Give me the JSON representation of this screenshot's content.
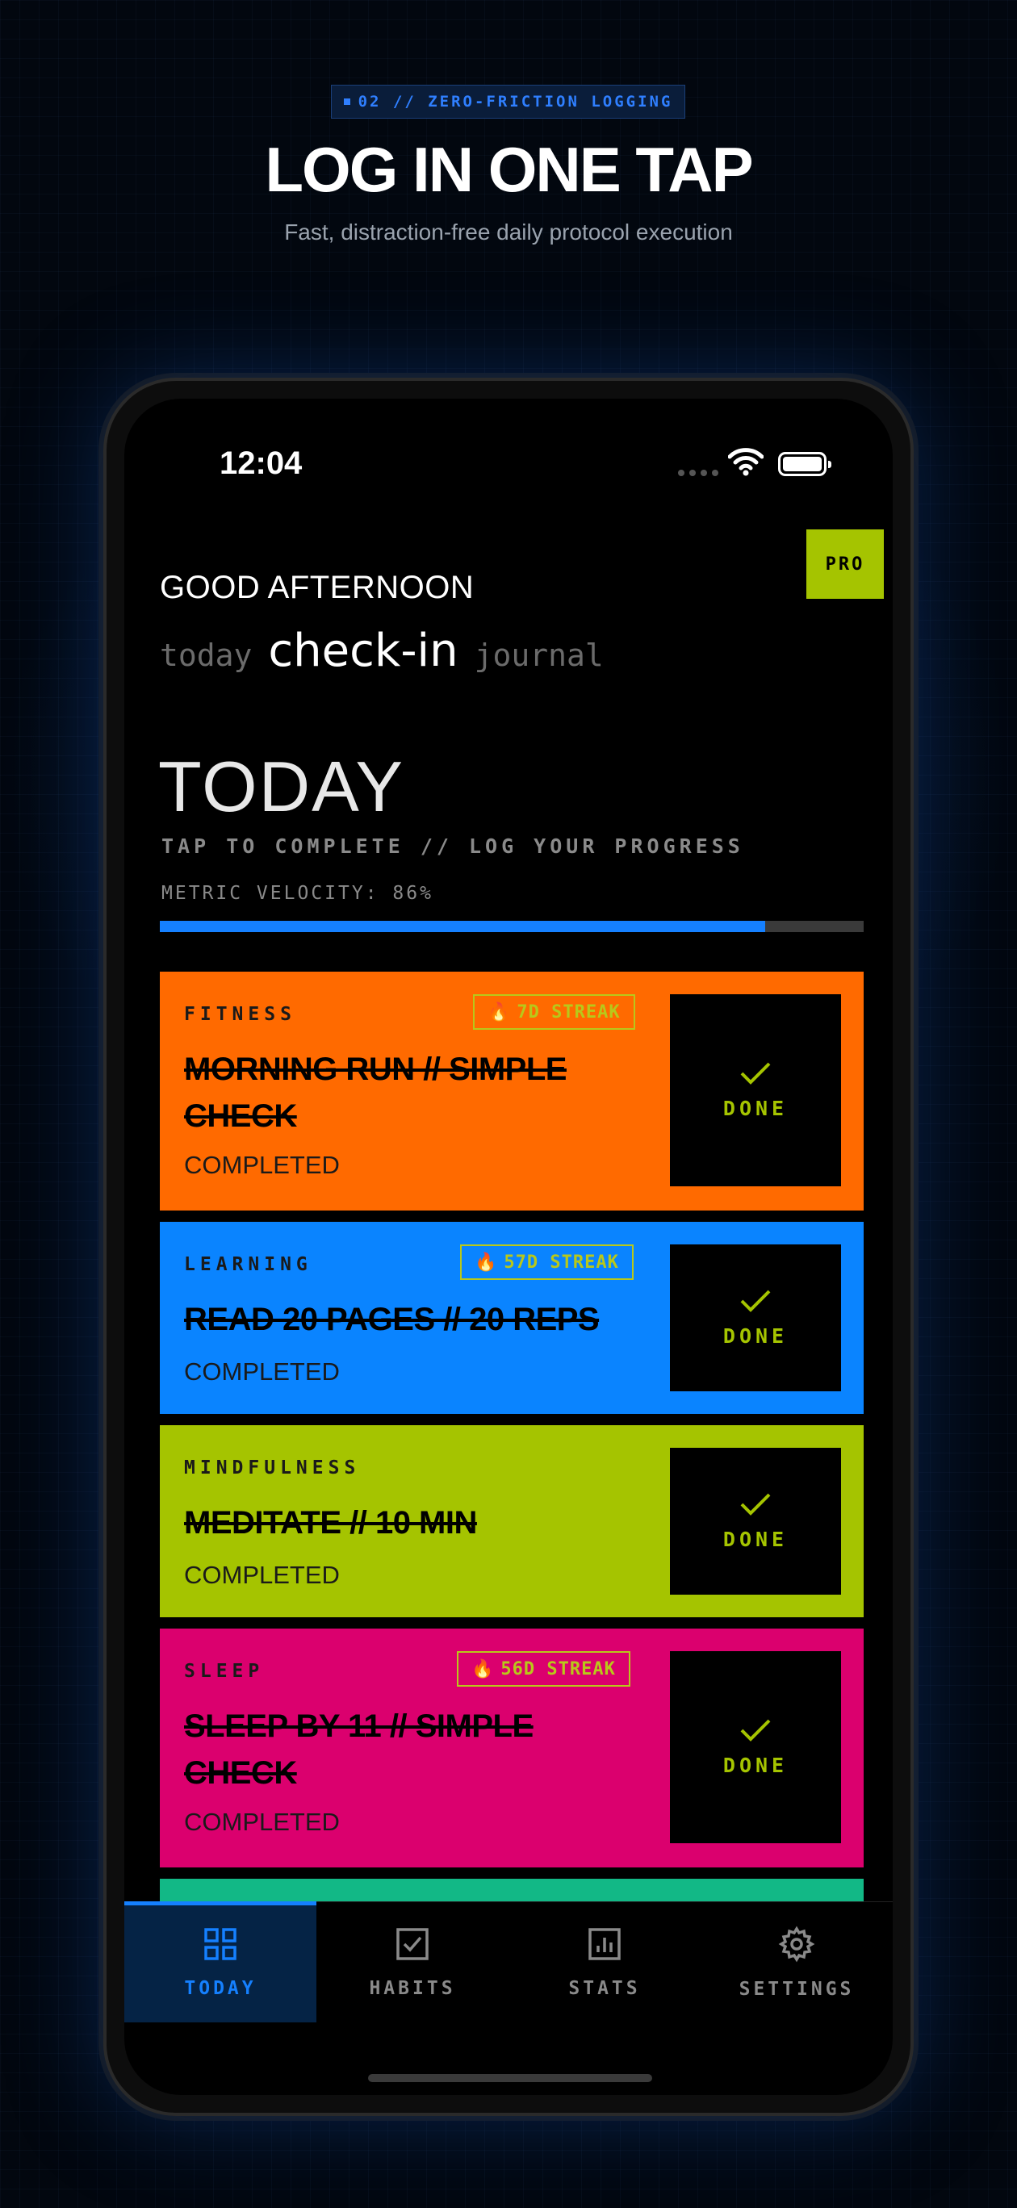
{
  "hero": {
    "badge": "02 // ZERO-FRICTION LOGGING",
    "title": "LOG IN ONE TAP",
    "subtitle": "Fast, distraction-free daily protocol execution"
  },
  "status": {
    "time": "12:04"
  },
  "header": {
    "pro": "PRO",
    "greeting": "GOOD AFTERNOON",
    "tabs": [
      {
        "label": "today",
        "active": false
      },
      {
        "label": "check-in",
        "active": true
      },
      {
        "label": "journal",
        "active": false
      }
    ]
  },
  "section": {
    "title": "TODAY",
    "subtitle": "TAP TO COMPLETE // LOG YOUR PROGRESS",
    "velocity_label": "METRIC VELOCITY: 86%",
    "velocity_value": 86
  },
  "habits": [
    {
      "category": "FITNESS",
      "streak": "7D STREAK",
      "name": "MORNING RUN // SIMPLE CHECK",
      "state": "COMPLETED",
      "done_label": "DONE",
      "color": "#ff6a00"
    },
    {
      "category": "LEARNING",
      "streak": "57D STREAK",
      "name": "READ 20 PAGES // 20 REPS",
      "state": "COMPLETED",
      "done_label": "DONE",
      "color": "#0a84ff"
    },
    {
      "category": "MINDFULNESS",
      "streak": "",
      "name": "MEDITATE // 10 MIN",
      "state": "COMPLETED",
      "done_label": "DONE",
      "color": "#a5c400"
    },
    {
      "category": "SLEEP",
      "streak": "56D STREAK",
      "name": "SLEEP BY 11 // SIMPLE CHECK",
      "state": "COMPLETED",
      "done_label": "DONE",
      "color": "#db006e"
    }
  ],
  "next_card_color": "#12b886",
  "tabbar": {
    "items": [
      {
        "label": "TODAY",
        "icon": "grid-icon",
        "active": true
      },
      {
        "label": "HABITS",
        "icon": "checkbox-icon",
        "active": false
      },
      {
        "label": "STATS",
        "icon": "bar-chart-icon",
        "active": false
      },
      {
        "label": "SETTINGS",
        "icon": "gear-icon",
        "active": false
      }
    ]
  },
  "colors": {
    "accent_blue": "#1580ff",
    "accent_lime": "#a5c400"
  }
}
